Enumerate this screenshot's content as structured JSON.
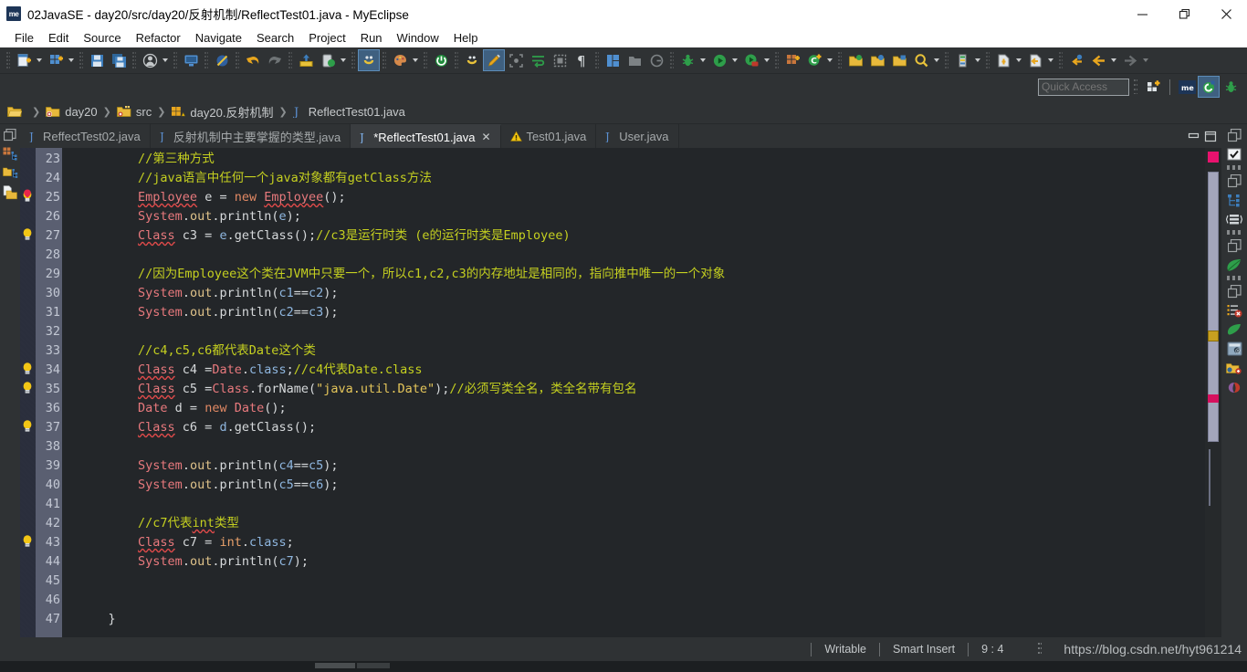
{
  "window": {
    "app_icon_text": "me",
    "title": "02JavaSE - day20/src/day20/反射机制/ReflectTest01.java - MyEclipse",
    "minimize_label": "Minimize",
    "maximize_label": "Restore",
    "close_label": "Close"
  },
  "menu": {
    "items": [
      "File",
      "Edit",
      "Source",
      "Refactor",
      "Navigate",
      "Search",
      "Project",
      "Run",
      "Window",
      "Help"
    ]
  },
  "quick_access": {
    "placeholder": "Quick Access",
    "value": "Quick Access"
  },
  "breadcrumb": {
    "items": [
      {
        "label": "",
        "icon": "open-folder-icon"
      },
      {
        "label": "day20",
        "icon": "project-icon"
      },
      {
        "label": "src",
        "icon": "source-folder-icon"
      },
      {
        "label": "day20.反射机制",
        "icon": "package-icon"
      },
      {
        "label": "ReflectTest01.java",
        "icon": "java-file-icon"
      }
    ]
  },
  "tabs": [
    {
      "label": "ReffectTest02.java",
      "icon": "java-file-icon",
      "active": false,
      "dirty": false
    },
    {
      "label": "反射机制中主要掌握的类型.java",
      "icon": "java-file-icon",
      "active": false,
      "dirty": false
    },
    {
      "label": "*ReflectTest01.java",
      "icon": "java-file-icon",
      "active": true,
      "dirty": true,
      "close": "✕"
    },
    {
      "label": "Test01.java",
      "icon": "warning-file-icon",
      "active": false,
      "dirty": false
    },
    {
      "label": "User.java",
      "icon": "java-file-icon",
      "active": false,
      "dirty": false
    }
  ],
  "editor": {
    "first_line": 23,
    "lines": [
      {
        "n": 23,
        "marker": "",
        "tokens": [
          {
            "t": "        ",
            "c": "pl"
          },
          {
            "t": "//第三种方式",
            "c": "cmt"
          }
        ]
      },
      {
        "n": 24,
        "marker": "",
        "tokens": [
          {
            "t": "        ",
            "c": "pl"
          },
          {
            "t": "//java语言中任何一个java对象都有getClass方法",
            "c": "cmt"
          }
        ]
      },
      {
        "n": 25,
        "marker": "breakpoint",
        "tokens": [
          {
            "t": "        ",
            "c": "pl"
          },
          {
            "t": "Employee",
            "c": "cls"
          },
          {
            "t": " e = ",
            "c": "pl"
          },
          {
            "t": "new",
            "c": "kw"
          },
          {
            "t": " ",
            "c": "pl"
          },
          {
            "t": "Employee",
            "c": "cls"
          },
          {
            "t": "();",
            "c": "pl"
          }
        ]
      },
      {
        "n": 26,
        "marker": "",
        "tokens": [
          {
            "t": "        ",
            "c": "pl"
          },
          {
            "t": "System",
            "c": "sys"
          },
          {
            "t": ".",
            "c": "pl"
          },
          {
            "t": "out",
            "c": "fld"
          },
          {
            "t": ".println(",
            "c": "pl"
          },
          {
            "t": "e",
            "c": "var"
          },
          {
            "t": ");",
            "c": "pl"
          }
        ]
      },
      {
        "n": 27,
        "marker": "bulb",
        "tokens": [
          {
            "t": "        ",
            "c": "pl"
          },
          {
            "t": "Class",
            "c": "cls"
          },
          {
            "t": " c3 = ",
            "c": "pl"
          },
          {
            "t": "e",
            "c": "var"
          },
          {
            "t": ".getClass();",
            "c": "pl"
          },
          {
            "t": "//c3是运行时类 (e的运行时类是Employee)",
            "c": "cmt"
          }
        ]
      },
      {
        "n": 28,
        "marker": "",
        "tokens": []
      },
      {
        "n": 29,
        "marker": "",
        "tokens": [
          {
            "t": "        ",
            "c": "pl"
          },
          {
            "t": "//因为Employee这个类在JVM中只要一个，所以c1,c2,c3的内存地址是相同的，指向推中唯一的一个对象",
            "c": "cmt"
          }
        ]
      },
      {
        "n": 30,
        "marker": "",
        "tokens": [
          {
            "t": "        ",
            "c": "pl"
          },
          {
            "t": "System",
            "c": "sys"
          },
          {
            "t": ".",
            "c": "pl"
          },
          {
            "t": "out",
            "c": "fld"
          },
          {
            "t": ".println(",
            "c": "pl"
          },
          {
            "t": "c1",
            "c": "var"
          },
          {
            "t": "==",
            "c": "pl"
          },
          {
            "t": "c2",
            "c": "var"
          },
          {
            "t": ");",
            "c": "pl"
          }
        ]
      },
      {
        "n": 31,
        "marker": "",
        "tokens": [
          {
            "t": "        ",
            "c": "pl"
          },
          {
            "t": "System",
            "c": "sys"
          },
          {
            "t": ".",
            "c": "pl"
          },
          {
            "t": "out",
            "c": "fld"
          },
          {
            "t": ".println(",
            "c": "pl"
          },
          {
            "t": "c2",
            "c": "var"
          },
          {
            "t": "==",
            "c": "pl"
          },
          {
            "t": "c3",
            "c": "var"
          },
          {
            "t": ");",
            "c": "pl"
          }
        ]
      },
      {
        "n": 32,
        "marker": "",
        "tokens": []
      },
      {
        "n": 33,
        "marker": "",
        "tokens": [
          {
            "t": "        ",
            "c": "pl"
          },
          {
            "t": "//c4,c5,c6都代表Date这个类",
            "c": "cmt"
          }
        ]
      },
      {
        "n": 34,
        "marker": "bulb",
        "tokens": [
          {
            "t": "        ",
            "c": "pl"
          },
          {
            "t": "Class",
            "c": "cls"
          },
          {
            "t": " c4 =",
            "c": "pl"
          },
          {
            "t": "Date",
            "c": "clsp"
          },
          {
            "t": ".",
            "c": "pl"
          },
          {
            "t": "class",
            "c": "var"
          },
          {
            "t": ";",
            "c": "pl"
          },
          {
            "t": "//c4代表Date.class",
            "c": "cmt"
          }
        ]
      },
      {
        "n": 35,
        "marker": "bulb",
        "tokens": [
          {
            "t": "        ",
            "c": "pl"
          },
          {
            "t": "Class",
            "c": "cls"
          },
          {
            "t": " c5 =",
            "c": "pl"
          },
          {
            "t": "Class",
            "c": "clsp"
          },
          {
            "t": ".forName(",
            "c": "pl"
          },
          {
            "t": "\"java.util.Date\"",
            "c": "str"
          },
          {
            "t": ");",
            "c": "pl"
          },
          {
            "t": "//必须写类全名，类全名带有包名",
            "c": "cmt"
          }
        ]
      },
      {
        "n": 36,
        "marker": "",
        "tokens": [
          {
            "t": "        ",
            "c": "pl"
          },
          {
            "t": "Date",
            "c": "clsp"
          },
          {
            "t": " d = ",
            "c": "pl"
          },
          {
            "t": "new",
            "c": "kw"
          },
          {
            "t": " ",
            "c": "pl"
          },
          {
            "t": "Date",
            "c": "clsp"
          },
          {
            "t": "();",
            "c": "pl"
          }
        ]
      },
      {
        "n": 37,
        "marker": "bulb",
        "tokens": [
          {
            "t": "        ",
            "c": "pl"
          },
          {
            "t": "Class",
            "c": "cls"
          },
          {
            "t": " c6 = ",
            "c": "pl"
          },
          {
            "t": "d",
            "c": "var"
          },
          {
            "t": ".getClass();",
            "c": "pl"
          }
        ]
      },
      {
        "n": 38,
        "marker": "",
        "tokens": []
      },
      {
        "n": 39,
        "marker": "",
        "tokens": [
          {
            "t": "        ",
            "c": "pl"
          },
          {
            "t": "System",
            "c": "sys"
          },
          {
            "t": ".",
            "c": "pl"
          },
          {
            "t": "out",
            "c": "fld"
          },
          {
            "t": ".println(",
            "c": "pl"
          },
          {
            "t": "c4",
            "c": "var"
          },
          {
            "t": "==",
            "c": "pl"
          },
          {
            "t": "c5",
            "c": "var"
          },
          {
            "t": ");",
            "c": "pl"
          }
        ]
      },
      {
        "n": 40,
        "marker": "",
        "tokens": [
          {
            "t": "        ",
            "c": "pl"
          },
          {
            "t": "System",
            "c": "sys"
          },
          {
            "t": ".",
            "c": "pl"
          },
          {
            "t": "out",
            "c": "fld"
          },
          {
            "t": ".println(",
            "c": "pl"
          },
          {
            "t": "c5",
            "c": "var"
          },
          {
            "t": "==",
            "c": "pl"
          },
          {
            "t": "c6",
            "c": "var"
          },
          {
            "t": ");",
            "c": "pl"
          }
        ]
      },
      {
        "n": 41,
        "marker": "",
        "tokens": []
      },
      {
        "n": 42,
        "marker": "",
        "tokens": [
          {
            "t": "        ",
            "c": "pl"
          },
          {
            "t": "//c7代表",
            "c": "cmt"
          },
          {
            "t": "int",
            "c": "cmt sqig"
          },
          {
            "t": "类型",
            "c": "cmt"
          }
        ]
      },
      {
        "n": 43,
        "marker": "bulb",
        "tokens": [
          {
            "t": "        ",
            "c": "pl"
          },
          {
            "t": "Class",
            "c": "cls"
          },
          {
            "t": " c7 = ",
            "c": "pl"
          },
          {
            "t": "int",
            "c": "kw2"
          },
          {
            "t": ".",
            "c": "pl"
          },
          {
            "t": "class",
            "c": "var"
          },
          {
            "t": ";",
            "c": "pl"
          }
        ]
      },
      {
        "n": 44,
        "marker": "",
        "tokens": [
          {
            "t": "        ",
            "c": "pl"
          },
          {
            "t": "System",
            "c": "sys"
          },
          {
            "t": ".",
            "c": "pl"
          },
          {
            "t": "out",
            "c": "fld"
          },
          {
            "t": ".println(",
            "c": "pl"
          },
          {
            "t": "c7",
            "c": "var"
          },
          {
            "t": ");",
            "c": "pl"
          }
        ]
      },
      {
        "n": 45,
        "marker": "",
        "tokens": []
      },
      {
        "n": 46,
        "marker": "",
        "tokens": []
      },
      {
        "n": 47,
        "marker": "",
        "tokens": [
          {
            "t": "    }",
            "c": "pl"
          }
        ]
      }
    ]
  },
  "statusbar": {
    "writable": "Writable",
    "insert_mode": "Smart Insert",
    "position": "9 : 4",
    "url": "https://blog.csdn.net/hyt961214"
  },
  "colors": {
    "accent_blue": "#3f6080",
    "comment_green": "#c5d020",
    "class_red": "#e8797d",
    "string_yellow": "#e5c65a",
    "variable_blue": "#8fb7e0",
    "toolbar_bg": "#2f3234",
    "editor_bg": "#232629",
    "gutter_bg": "#5a5f71",
    "titlebar_bg": "#ffffff",
    "tab_active_bg": "#3a3d40"
  }
}
